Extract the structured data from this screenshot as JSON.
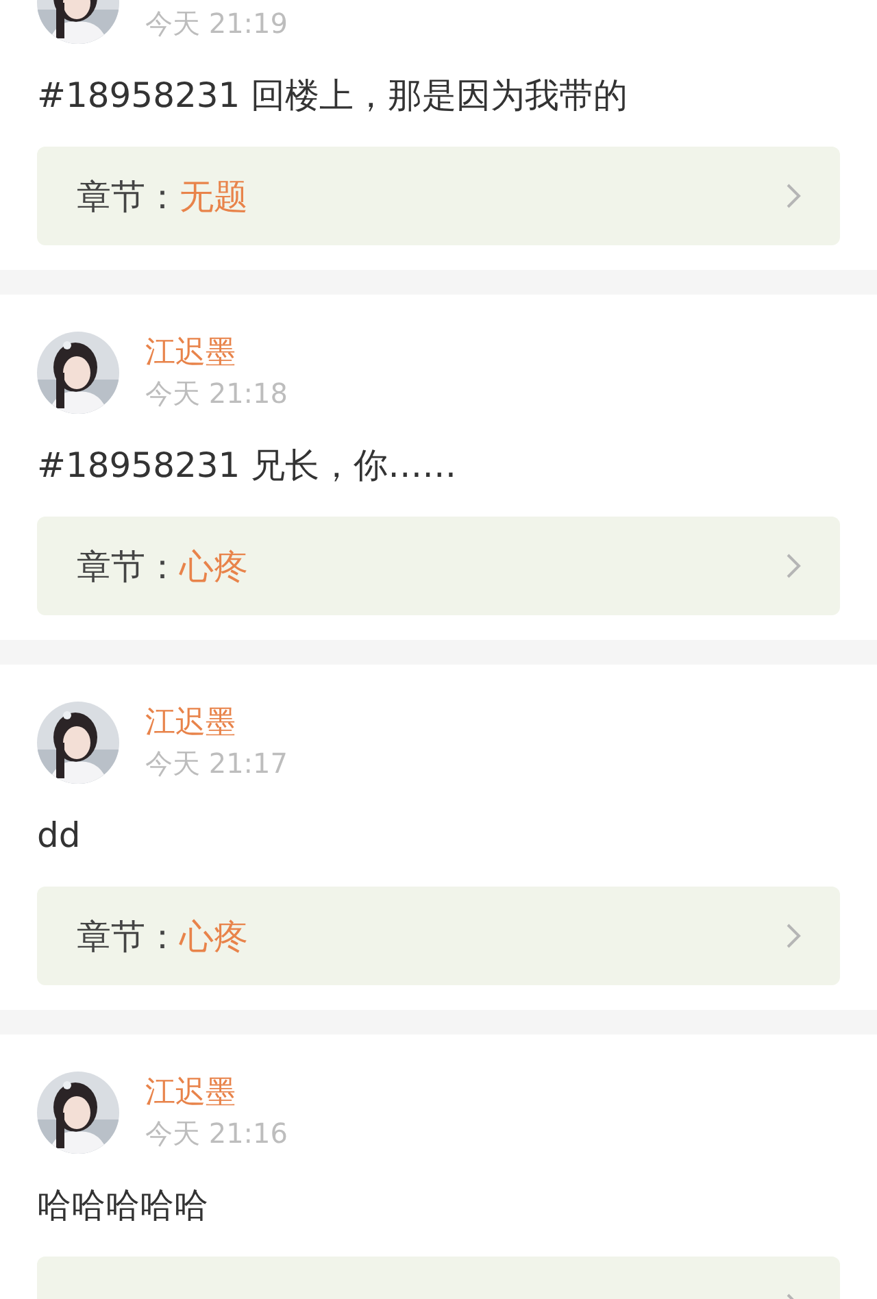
{
  "comments": [
    {
      "time": "今天 21:19",
      "text": "#18958231 回楼上，那是因为我带的",
      "chapter_label": "章节：",
      "chapter": "无题"
    },
    {
      "author": "江迟墨",
      "time": "今天 21:18",
      "text": "#18958231 兄长，你……",
      "chapter_label": "章节：",
      "chapter": "心疼"
    },
    {
      "author": "江迟墨",
      "time": "今天 21:17",
      "text": "dd",
      "chapter_label": "章节：",
      "chapter": "心疼"
    },
    {
      "author": "江迟墨",
      "time": "今天 21:16",
      "text": "哈哈哈哈哈"
    }
  ]
}
